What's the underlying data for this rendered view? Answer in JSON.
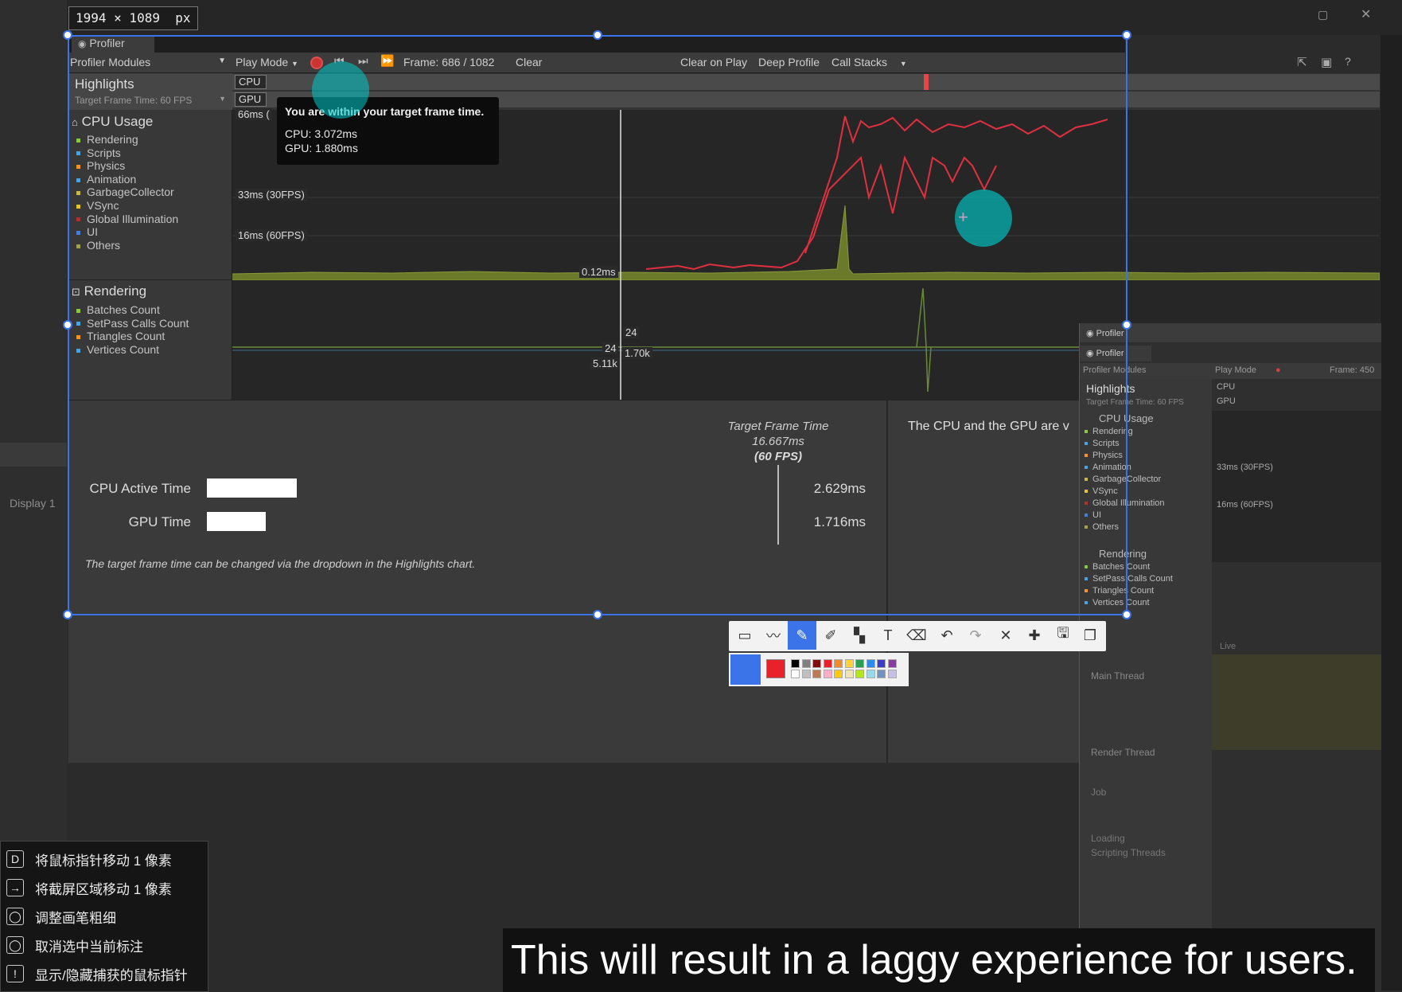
{
  "dimension_badge": "1994 × 1089  px",
  "profiler": {
    "tab": "Profiler",
    "toolbar": {
      "modules": "Profiler Modules",
      "play_mode": "Play Mode",
      "frame": "Frame: 686 / 1082",
      "clear": "Clear",
      "clear_on_play": "Clear on Play",
      "deep_profile": "Deep Profile",
      "call_stacks": "Call Stacks"
    },
    "highlights": {
      "title": "Highlights",
      "target": "Target Frame Time: 60 FPS",
      "cpu": "CPU",
      "gpu": "GPU"
    },
    "cpu_usage": {
      "title": "CPU Usage",
      "items": [
        {
          "label": "Rendering",
          "color": "#8dc63f"
        },
        {
          "label": "Scripts",
          "color": "#4aa3df"
        },
        {
          "label": "Physics",
          "color": "#f7941d"
        },
        {
          "label": "Animation",
          "color": "#4aa3df"
        },
        {
          "label": "GarbageCollector",
          "color": "#c8b84a"
        },
        {
          "label": "VSync",
          "color": "#e6c32b"
        },
        {
          "label": "Global Illumination",
          "color": "#b03030"
        },
        {
          "label": "UI",
          "color": "#4a7fd6"
        },
        {
          "label": "Others",
          "color": "#a0a050"
        }
      ]
    },
    "rendering": {
      "title": "Rendering",
      "items": [
        {
          "label": "Batches Count",
          "color": "#8dc63f"
        },
        {
          "label": "SetPass Calls Count",
          "color": "#4aa3df"
        },
        {
          "label": "Triangles Count",
          "color": "#f7941d"
        },
        {
          "label": "Vertices Count",
          "color": "#4aa3df"
        }
      ]
    },
    "chart_labels": {
      "ms66": "66ms (",
      "ms33": "33ms (30FPS)",
      "ms16": "16ms (60FPS)",
      "ms012": "0.12ms",
      "r24a": "24",
      "r24b": "24",
      "r170k": "1.70k",
      "r511k": "5.11k"
    },
    "tooltip": {
      "title": "You are within your target frame time.",
      "cpu": "CPU: 3.072ms",
      "gpu": "GPU: 1.880ms"
    },
    "details": {
      "target_title": "Target Frame Time",
      "target_ms": "16.667ms",
      "target_fps": "(60 FPS)",
      "cpu_label": "CPU Active Time",
      "cpu_value": "2.629ms",
      "cpu_fraction": 0.158,
      "gpu_label": "GPU Time",
      "gpu_value": "1.716ms",
      "gpu_fraction": 0.103,
      "note": "The target frame time can be changed via the dropdown in the Highlights chart.",
      "right_msg": "The CPU and the GPU are v"
    }
  },
  "mini_profiler": {
    "window_title": "Profiler",
    "tab": "Profiler",
    "modules": "Profiler Modules",
    "play_mode": "Play Mode",
    "frame": "Frame: 450",
    "highlights": "Highlights",
    "target": "Target Frame Time: 60 FPS",
    "cpu": "CPU",
    "gpu": "GPU",
    "cpu_usage": "CPU Usage",
    "cpu_items": [
      "Rendering",
      "Scripts",
      "Physics",
      "Animation",
      "GarbageCollector",
      "VSync",
      "Global Illumination",
      "UI",
      "Others"
    ],
    "cpu_item_colors": [
      "#8dc63f",
      "#4aa3df",
      "#f7941d",
      "#4aa3df",
      "#c8b84a",
      "#e6c32b",
      "#b03030",
      "#4a7fd6",
      "#a0a050"
    ],
    "ms33": "33ms (30FPS)",
    "ms16": "16ms (60FPS)",
    "rendering": "Rendering",
    "rendering_items": [
      "Batches Count",
      "SetPass Calls Count",
      "Triangles Count",
      "Vertices Count"
    ],
    "rendering_colors": [
      "#8dc63f",
      "#4aa3df",
      "#f7941d",
      "#4aa3df"
    ],
    "live": "Live",
    "threads": [
      "Main Thread",
      "Render Thread",
      "Job",
      "Loading",
      "Scripting Threads"
    ]
  },
  "left_panel": {
    "display": "Display 1"
  },
  "annotation_toolbar": {
    "tools": [
      "rectangle-icon",
      "line-icon",
      "pen-icon",
      "marker-icon",
      "mosaic-icon",
      "text-icon",
      "eraser-icon",
      "undo-icon",
      "redo-icon",
      "close-icon",
      "pin-icon",
      "save-icon",
      "copy-icon"
    ],
    "active_color": "#e8222a",
    "palette_row1": [
      "#000000",
      "#808080",
      "#7f0f0f",
      "#e8222a",
      "#f08c2c",
      "#ffd23c",
      "#28a050",
      "#2c8ce8",
      "#3c3cc8",
      "#8c3ca0"
    ],
    "palette_row2": [
      "#ffffff",
      "#c0c0c0",
      "#b97a56",
      "#ffaec9",
      "#ffc90e",
      "#efe4b0",
      "#b5e61d",
      "#99d9ea",
      "#7092be",
      "#c8bfe7"
    ]
  },
  "shortcuts": [
    {
      "key": "D",
      "label": "将鼠标指针移动 1 像素"
    },
    {
      "key": "→",
      "label": "将截屏区域移动 1 像素"
    },
    {
      "key": "◯",
      "label": "调整画笔粗细"
    },
    {
      "key": "◯",
      "label": "取消选中当前标注"
    },
    {
      "key": "!",
      "label": "显示/隐藏捕获的鼠标指针"
    }
  ],
  "subtitle": "This will result in a laggy experience for users."
}
